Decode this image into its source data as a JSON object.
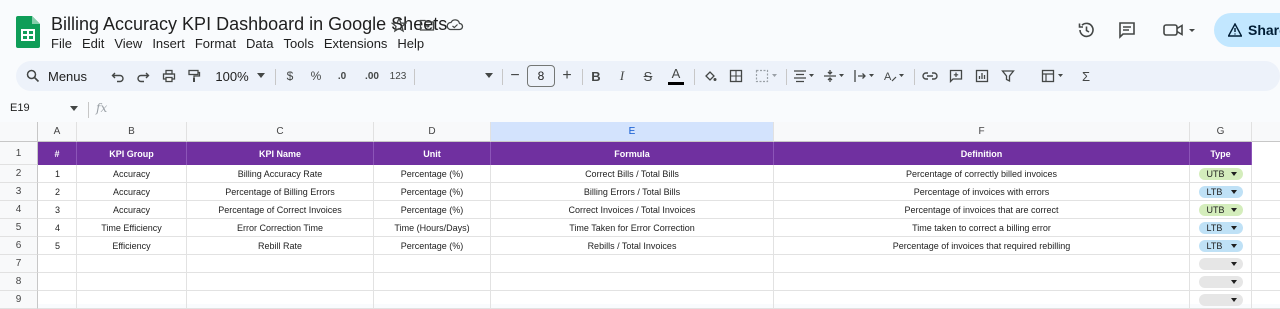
{
  "app": {
    "title": "Billing Accuracy KPI Dashboard in Google Sheets",
    "menu": [
      "File",
      "Edit",
      "View",
      "Insert",
      "Format",
      "Data",
      "Tools",
      "Extensions",
      "Help"
    ],
    "share_label": "Share"
  },
  "toolbar": {
    "search_label": "Menus",
    "zoom": "100%",
    "currency": "$",
    "percent": "%",
    "dec_decrease": ".0",
    "dec_increase": ".00",
    "number_format": "123",
    "font_size": "8",
    "minus": "−",
    "plus": "+",
    "bold": "B",
    "italic": "I",
    "strike": "S",
    "text_color": "A",
    "sigma": "Σ"
  },
  "formula_bar": {
    "name_box": "E19",
    "fx": "fx"
  },
  "columns": [
    "A",
    "B",
    "C",
    "D",
    "E",
    "F",
    "G"
  ],
  "rows": [
    "1",
    "2",
    "3",
    "4",
    "5",
    "6",
    "7",
    "8",
    "9"
  ],
  "header": [
    "#",
    "KPI Group",
    "KPI Name",
    "Unit",
    "Formula",
    "Definition",
    "Type"
  ],
  "data": [
    {
      "num": "1",
      "group": "Accuracy",
      "name": "Billing Accuracy Rate",
      "unit": "Percentage (%)",
      "formula": "Correct Bills / Total Bills",
      "definition": "Percentage of correctly billed invoices",
      "type": "UTB"
    },
    {
      "num": "2",
      "group": "Accuracy",
      "name": "Percentage of Billing Errors",
      "unit": "Percentage (%)",
      "formula": "Billing Errors / Total Bills",
      "definition": "Percentage of invoices with errors",
      "type": "LTB"
    },
    {
      "num": "3",
      "group": "Accuracy",
      "name": "Percentage of Correct Invoices",
      "unit": "Percentage (%)",
      "formula": "Correct Invoices / Total Invoices",
      "definition": "Percentage of invoices that are correct",
      "type": "UTB"
    },
    {
      "num": "4",
      "group": "Time Efficiency",
      "name": "Error Correction Time",
      "unit": "Time (Hours/Days)",
      "formula": "Time Taken for Error Correction",
      "definition": "Time taken to correct a billing error",
      "type": "LTB"
    },
    {
      "num": "5",
      "group": "Efficiency",
      "name": "Rebill Rate",
      "unit": "Percentage (%)",
      "formula": "Rebills / Total Invoices",
      "definition": "Percentage of invoices that required rebilling",
      "type": "LTB"
    }
  ],
  "colors": {
    "header_bg": "#7030a0",
    "utb_chip": "#d4edbc",
    "ltb_chip": "#bfe1f6",
    "empty_chip": "#e6e6e6",
    "share_bg": "#c2e7ff"
  },
  "icons": [
    "sheets-logo-icon",
    "star-icon",
    "move-folder-icon",
    "cloud-status-icon",
    "history-icon",
    "comment-icon",
    "video-call-icon",
    "warning-icon"
  ]
}
